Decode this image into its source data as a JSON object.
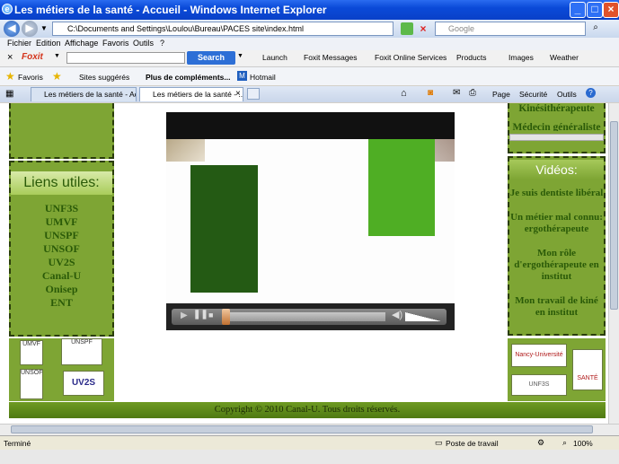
{
  "window": {
    "title": "Les métiers de la santé - Accueil - Windows Internet Explorer"
  },
  "address": {
    "url": "C:\\Documents and Settings\\Loulou\\Bureau\\PACES site\\index.html",
    "search_placeholder": "Google"
  },
  "menu": [
    "Fichier",
    "Edition",
    "Affichage",
    "Favoris",
    "Outils",
    "?"
  ],
  "foxit": {
    "brand": "Foxit",
    "search_label": "Search",
    "items": [
      "Launch",
      "Foxit Messages",
      "Foxit Online Services",
      "Products",
      "Images",
      "Weather"
    ]
  },
  "favorites": {
    "label": "Favoris",
    "items": [
      "Sites suggérés",
      "Plus de compléments...",
      "Hotmail"
    ]
  },
  "tabs": [
    {
      "label": "Les métiers de la santé - Acc..."
    },
    {
      "label": "Les métiers de la santé - ..."
    }
  ],
  "command_bar": [
    "Page",
    "Sécurité",
    "Outils"
  ],
  "page": {
    "left_links_title": "Liens utiles:",
    "left_links": [
      "UNF3S",
      "UMVF",
      "UNSPF",
      "UNSOF",
      "UV2S",
      "Canal-U",
      "Onisep",
      "ENT"
    ],
    "right_top_items": [
      "Kinésithérapeute",
      "Médecin généraliste"
    ],
    "videos_title": "Vidéos:",
    "videos": [
      "Je suis dentiste libéral",
      "Un métier mal connu: ergothérapeute",
      "Mon rôle d'ergothérapeute en institut",
      "Mon travail de kiné en institut"
    ],
    "logos_left": [
      "UMVF",
      "UNSPF",
      "UNSOF",
      "UV2S"
    ],
    "logos_right": [
      "Nancy-Université",
      "SANTÉ",
      "UNF3S"
    ],
    "footer": "Copyright © 2010 Canal-U. Tous droits réservés."
  },
  "status": {
    "text": "Terminé",
    "zone": "Poste de travail",
    "zoom": "100%"
  },
  "colors": {
    "page_green": "#7ea534",
    "link_green": "#2a5a08",
    "video_dark_green": "#245a14",
    "video_bright_green": "#4fae24"
  }
}
